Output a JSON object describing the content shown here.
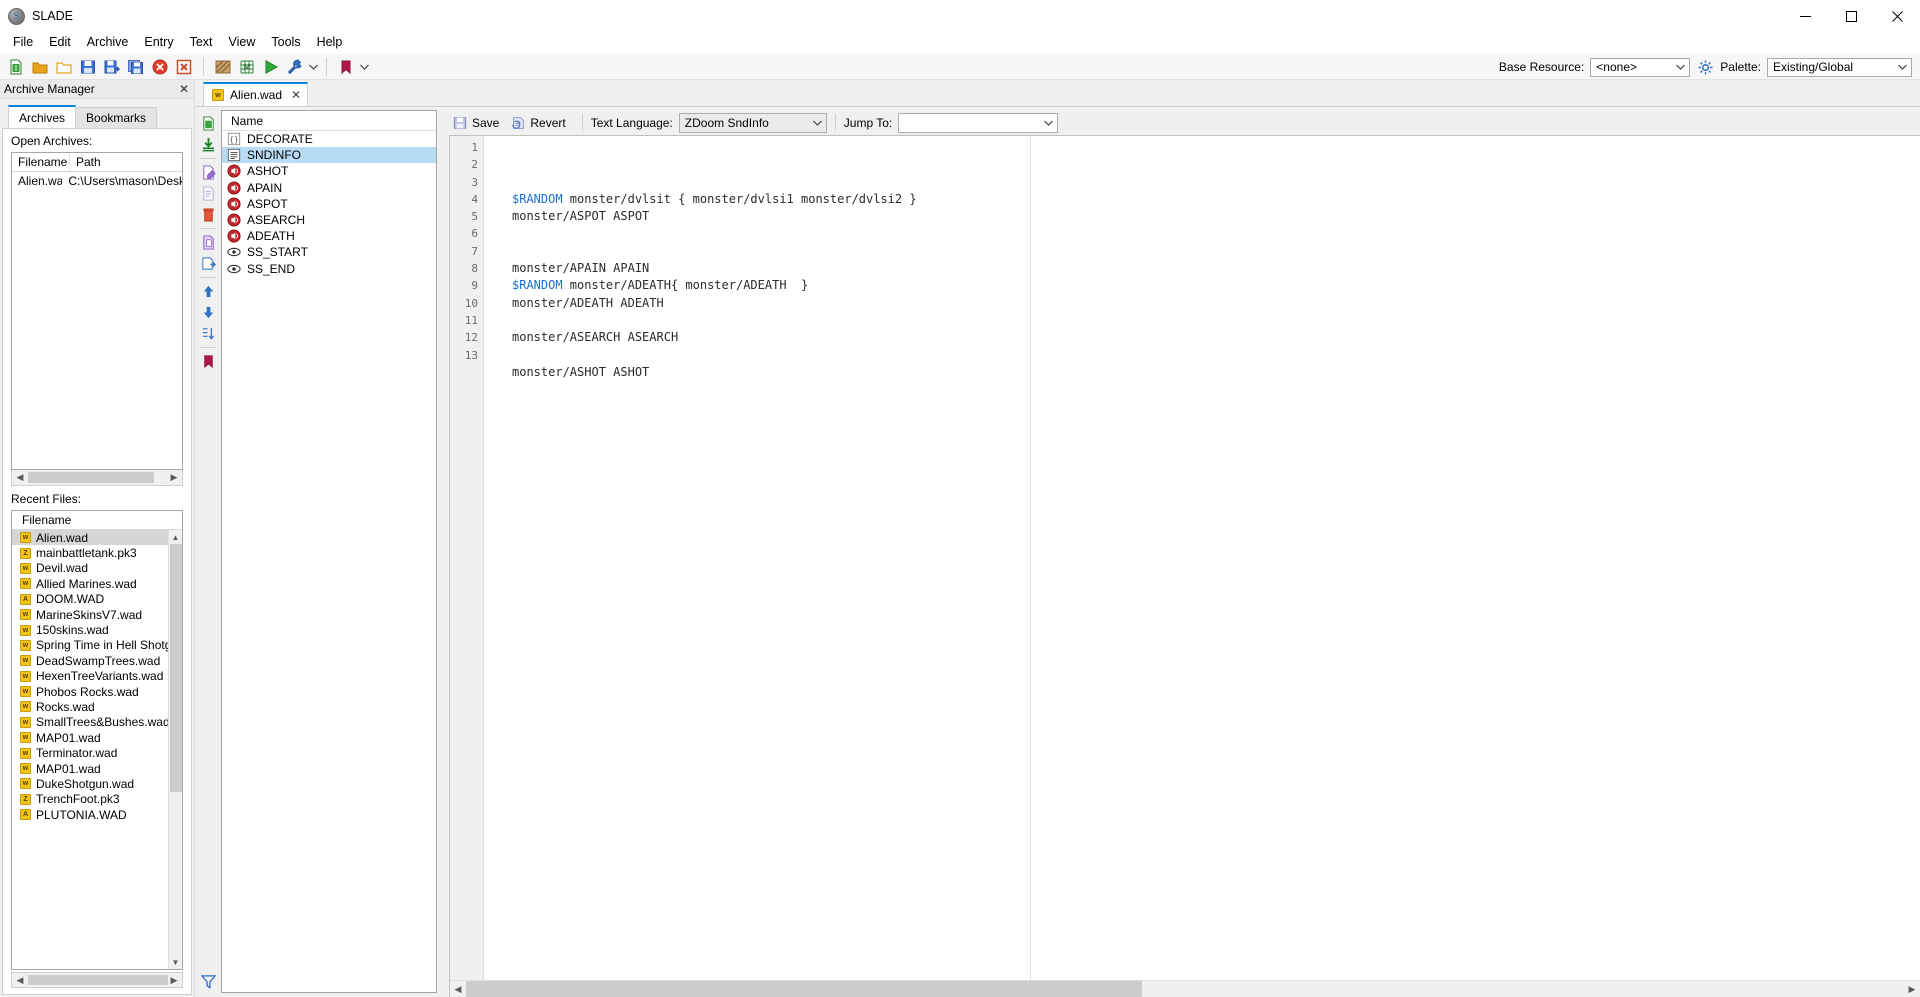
{
  "window": {
    "title": "SLADE",
    "logo_icon": "slade-logo-icon",
    "minimize": "─",
    "maximize": "❐",
    "close": "✕"
  },
  "menubar": {
    "items": [
      "File",
      "Edit",
      "Archive",
      "Entry",
      "Text",
      "View",
      "Tools",
      "Help"
    ]
  },
  "toolbar": {
    "buttons": [
      {
        "name": "new-archive-icon",
        "title": "New Archive"
      },
      {
        "name": "open-archive-icon",
        "title": "Open Archive"
      },
      {
        "name": "open-directory-icon",
        "title": "Open Directory"
      },
      {
        "name": "save-archive-icon",
        "title": "Save"
      },
      {
        "name": "save-as-icon",
        "title": "Save As"
      },
      {
        "name": "save-all-icon",
        "title": "Save All"
      },
      {
        "name": "close-archive-icon",
        "title": "Close"
      },
      {
        "name": "close-all-icon",
        "title": "Close All"
      },
      {
        "name": "texture-editor-icon",
        "title": "Texture Editor"
      },
      {
        "name": "map-editor-icon",
        "title": "Map Editor"
      },
      {
        "name": "run-icon",
        "title": "Run"
      },
      {
        "name": "preferences-wrench-icon",
        "title": "Preferences"
      },
      {
        "name": "bookmarks-icon",
        "title": "Bookmarks"
      }
    ],
    "base_resource_label": "Base Resource:",
    "base_resource_value": "<none>",
    "gear_icon": "gear-icon",
    "palette_label": "Palette:",
    "palette_value": "Existing/Global"
  },
  "archive_manager": {
    "panel_title": "Archive Manager",
    "close_icon": "✕",
    "tabs": [
      {
        "label": "Archives",
        "active": true
      },
      {
        "label": "Bookmarks",
        "active": false
      }
    ],
    "open_archives_label": "Open Archives:",
    "columns": [
      "Filename",
      "Path"
    ],
    "rows": [
      {
        "filename": "Alien.wad",
        "path": "C:\\Users\\mason\\Desktop"
      }
    ],
    "recent_files_label": "Recent Files:",
    "recent_column": "Filename",
    "recent_files": [
      {
        "name": "Alien.wad",
        "kind": "w",
        "selected": true
      },
      {
        "name": "mainbattletank.pk3",
        "kind": "z",
        "selected": false
      },
      {
        "name": "Devil.wad",
        "kind": "w",
        "selected": false
      },
      {
        "name": "Allied Marines.wad",
        "kind": "w",
        "selected": false
      },
      {
        "name": "DOOM.WAD",
        "kind": "a",
        "selected": false
      },
      {
        "name": "MarineSkinsV7.wad",
        "kind": "w",
        "selected": false
      },
      {
        "name": "150skins.wad",
        "kind": "w",
        "selected": false
      },
      {
        "name": "Spring Time in Hell Shotgun.wa",
        "kind": "w",
        "selected": false
      },
      {
        "name": "DeadSwampTrees.wad",
        "kind": "w",
        "selected": false
      },
      {
        "name": "HexenTreeVariants.wad",
        "kind": "w",
        "selected": false
      },
      {
        "name": "Phobos Rocks.wad",
        "kind": "w",
        "selected": false
      },
      {
        "name": "Rocks.wad",
        "kind": "w",
        "selected": false
      },
      {
        "name": "SmallTrees&Bushes.wad",
        "kind": "w",
        "selected": false
      },
      {
        "name": "MAP01.wad",
        "kind": "w",
        "selected": false
      },
      {
        "name": "Terminator.wad",
        "kind": "w",
        "selected": false
      },
      {
        "name": "MAP01.wad",
        "kind": "w",
        "selected": false
      },
      {
        "name": "DukeShotgun.wad",
        "kind": "w",
        "selected": false
      },
      {
        "name": "TrenchFoot.pk3",
        "kind": "z",
        "selected": false
      },
      {
        "name": "PLUTONIA.WAD",
        "kind": "a",
        "selected": false
      }
    ]
  },
  "editor_tabs": [
    {
      "label": "Alien.wad",
      "icon": "wad-file-icon",
      "close_icon": "✕",
      "active": true
    }
  ],
  "entry_tools": [
    {
      "name": "new-entry-icon"
    },
    {
      "name": "import-entry-icon"
    },
    {
      "name": "rename-entry-icon"
    },
    {
      "name": "edit-entry-icon"
    },
    {
      "name": "delete-entry-icon"
    },
    {
      "name": "copy-entry-icon"
    },
    {
      "name": "paste-entry-icon"
    },
    {
      "name": "move-up-icon"
    },
    {
      "name": "move-down-icon"
    },
    {
      "name": "sort-icon"
    },
    {
      "name": "bookmark-icon"
    },
    {
      "name": "filter-icon"
    }
  ],
  "entry_list": {
    "column": "Name",
    "entries": [
      {
        "name": "DECORATE",
        "icon": "text-braces-icon",
        "selected": false
      },
      {
        "name": "SNDINFO",
        "icon": "text-lines-icon",
        "selected": true
      },
      {
        "name": "ASHOT",
        "icon": "sound-icon",
        "selected": false
      },
      {
        "name": "APAIN",
        "icon": "sound-icon",
        "selected": false
      },
      {
        "name": "ASPOT",
        "icon": "sound-icon",
        "selected": false
      },
      {
        "name": "ASEARCH",
        "icon": "sound-icon",
        "selected": false
      },
      {
        "name": "ADEATH",
        "icon": "sound-icon",
        "selected": false
      },
      {
        "name": "SS_START",
        "icon": "marker-eye-icon",
        "selected": false
      },
      {
        "name": "SS_END",
        "icon": "marker-eye-icon",
        "selected": false
      }
    ]
  },
  "text_editor": {
    "save_label": "Save",
    "save_icon": "save-icon",
    "revert_label": "Revert",
    "revert_icon": "revert-icon",
    "language_label": "Text Language:",
    "language_value": "ZDoom SndInfo",
    "jump_to_label": "Jump To:",
    "jump_to_value": "",
    "line_numbers": [
      "1",
      "2",
      "3",
      "4",
      "5",
      "6",
      "7",
      "8",
      "9",
      "10",
      "11",
      "12",
      "13"
    ],
    "lines": [
      {
        "n": 1,
        "segments": [
          {
            "t": "$RANDOM",
            "cls": "kw"
          },
          {
            "t": " monster/dvlsit { monster/dvlsi1 monster/dvlsi2 }",
            "cls": "sig"
          }
        ]
      },
      {
        "n": 2,
        "segments": [
          {
            "t": "monster/ASPOT ASPOT",
            "cls": "sig"
          }
        ]
      },
      {
        "n": 3,
        "segments": [
          {
            "t": "",
            "cls": "sig"
          }
        ]
      },
      {
        "n": 4,
        "segments": [
          {
            "t": "",
            "cls": "sig"
          }
        ]
      },
      {
        "n": 5,
        "segments": [
          {
            "t": "monster/APAIN APAIN",
            "cls": "sig"
          }
        ]
      },
      {
        "n": 6,
        "segments": [
          {
            "t": "$RANDOM",
            "cls": "kw"
          },
          {
            "t": " monster/ADEATH{ monster/ADEATH  }",
            "cls": "sig"
          }
        ]
      },
      {
        "n": 7,
        "segments": [
          {
            "t": "monster/ADEATH ADEATH",
            "cls": "sig"
          }
        ]
      },
      {
        "n": 8,
        "segments": [
          {
            "t": "",
            "cls": "sig"
          }
        ]
      },
      {
        "n": 9,
        "segments": [
          {
            "t": "monster/ASEARCH ASEARCH",
            "cls": "sig"
          }
        ]
      },
      {
        "n": 10,
        "segments": [
          {
            "t": "",
            "cls": "sig"
          }
        ]
      },
      {
        "n": 11,
        "segments": [
          {
            "t": "monster/ASHOT ASHOT",
            "cls": "sig"
          }
        ]
      },
      {
        "n": 12,
        "segments": [
          {
            "t": "",
            "cls": "sig"
          }
        ]
      },
      {
        "n": 13,
        "segments": [
          {
            "t": "",
            "cls": "sig"
          }
        ]
      }
    ]
  },
  "colors": {
    "accent": "#0a84d8",
    "keyword": "#1a6fd4",
    "selection": "#b8dcf4",
    "recent_selection": "#d6d6d6",
    "wad_icon": "#f0c419",
    "sound_icon": "#c1272d",
    "toolbar_bg": "#f6f6f6"
  }
}
